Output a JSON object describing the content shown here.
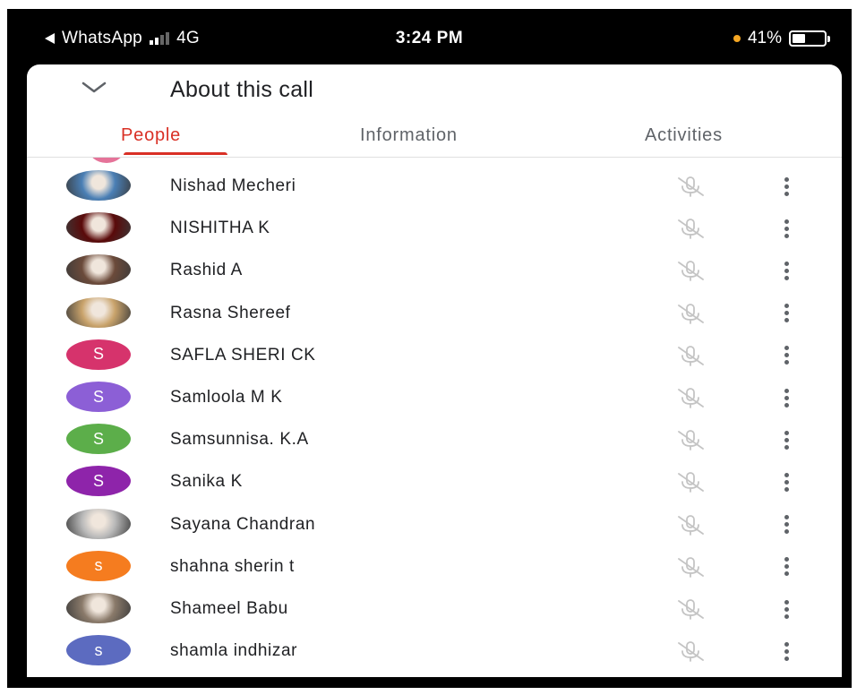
{
  "status_bar": {
    "back_app": "WhatsApp",
    "network": "4G",
    "time": "3:24 PM",
    "battery_percent": "41%",
    "battery_level": 0.41
  },
  "sheet": {
    "title": "About this call",
    "collapse_icon": "chevron-down-icon"
  },
  "tabs": [
    {
      "label": "People",
      "active": true
    },
    {
      "label": "Information",
      "active": false
    },
    {
      "label": "Activities",
      "active": false
    }
  ],
  "participants": [
    {
      "name": "Nishad Mecheri",
      "avatar": {
        "type": "photo",
        "color": "#4a7fb5"
      }
    },
    {
      "name": "NISHITHA K",
      "avatar": {
        "type": "photo",
        "color": "#5a0a0a"
      }
    },
    {
      "name": "Rashid A",
      "avatar": {
        "type": "photo",
        "color": "#6b4a3a"
      }
    },
    {
      "name": "Rasna Shereef",
      "avatar": {
        "type": "photo",
        "color": "#c9a36b"
      }
    },
    {
      "name": "SAFLA SHERI CK",
      "avatar": {
        "type": "letter",
        "letter": "S",
        "color": "#d6336c"
      }
    },
    {
      "name": "Samloola M K",
      "avatar": {
        "type": "letter",
        "letter": "S",
        "color": "#8c5fd6"
      }
    },
    {
      "name": "Samsunnisa. K.A",
      "avatar": {
        "type": "letter",
        "letter": "S",
        "color": "#5cae4a"
      }
    },
    {
      "name": "Sanika K",
      "avatar": {
        "type": "letter",
        "letter": "S",
        "color": "#8e24aa"
      }
    },
    {
      "name": "Sayana Chandran",
      "avatar": {
        "type": "photo",
        "color": "#b9b9b9"
      }
    },
    {
      "name": "shahna sherin t",
      "avatar": {
        "type": "letter",
        "letter": "s",
        "color": "#f57c1f"
      }
    },
    {
      "name": "Shameel Babu",
      "avatar": {
        "type": "photo",
        "color": "#8a7a6a"
      }
    },
    {
      "name": "shamla indhizar",
      "avatar": {
        "type": "letter",
        "letter": "s",
        "color": "#5c6bc0"
      }
    }
  ],
  "row_icons": {
    "mic": "mic-off-icon",
    "more": "more-vert-icon"
  },
  "colors": {
    "accent": "#d93025",
    "text_primary": "#202124",
    "text_secondary": "#5f6368"
  }
}
